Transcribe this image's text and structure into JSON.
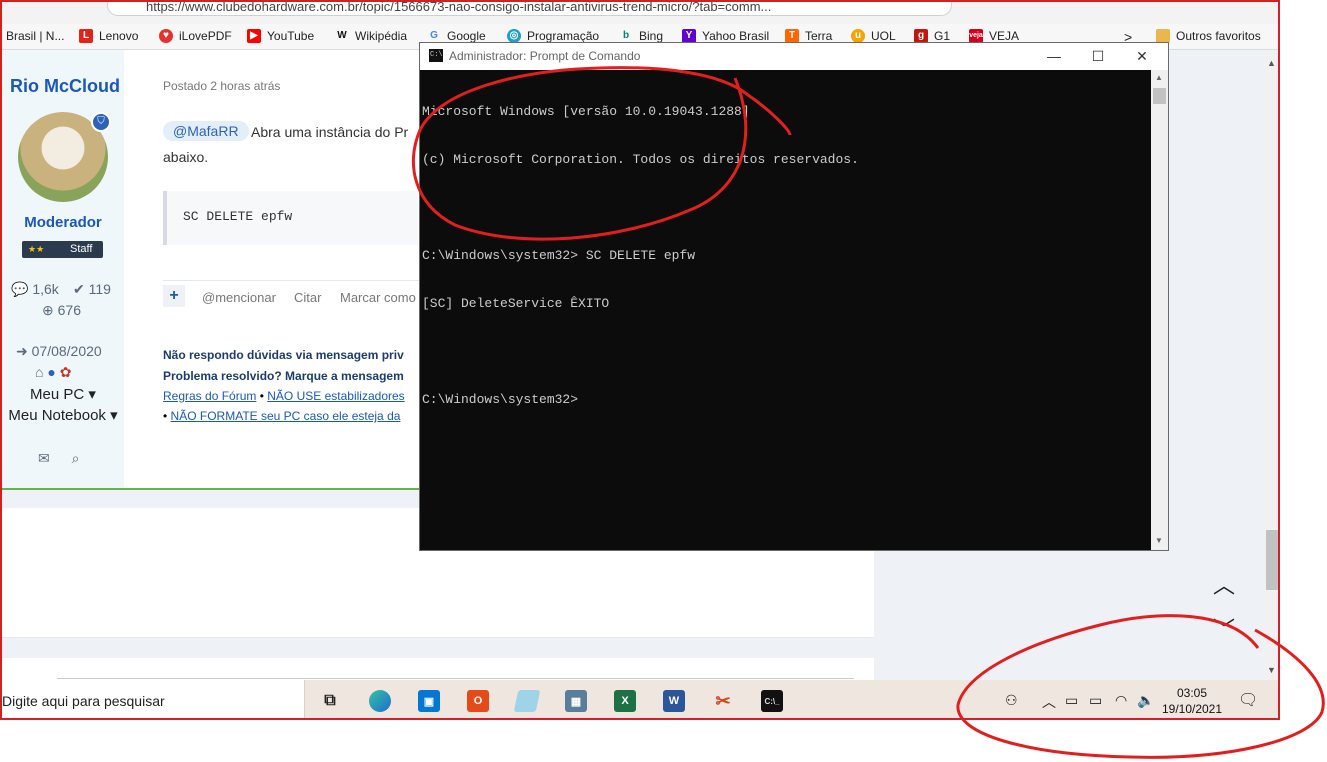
{
  "browser": {
    "url": "https://www.clubedohardware.com.br/topic/1566673-nao-consigo-instalar-antivirus-trend-micro/?tab=comm...",
    "bookmarks": [
      {
        "label": "Brasil | N..."
      },
      {
        "label": "Lenovo"
      },
      {
        "label": "iLovePDF"
      },
      {
        "label": "YouTube"
      },
      {
        "label": "Wikipédia"
      },
      {
        "label": "Google"
      },
      {
        "label": "Programação"
      },
      {
        "label": "Bing"
      },
      {
        "label": "Yahoo Brasil"
      },
      {
        "label": "Terra"
      },
      {
        "label": "UOL"
      },
      {
        "label": "G1"
      },
      {
        "label": "VEJA"
      }
    ],
    "more_chevron": ">",
    "other_favorites": "Outros favoritos"
  },
  "author": {
    "name": "Rio McCloud",
    "role": "Moderador",
    "badge": "Staff",
    "stars": "★★",
    "posts": "1,6k",
    "solutions": "119",
    "reputation": "676",
    "joined": "07/08/2020",
    "menu": [
      "Meu PC ▾",
      "Meu Notebook ▾"
    ]
  },
  "post": {
    "posted": "Postado 2 horas atrás",
    "mention": "@MafaRR",
    "text_line1": "Abra uma instância do Pr",
    "text_line2": "abaixo.",
    "code": "SC DELETE epfw",
    "actions": {
      "plus": "+",
      "mention": "@mencionar",
      "quote": "Citar",
      "mark": "Marcar como"
    },
    "signature": {
      "line1": "Não respondo dúvidas via mensagem priv",
      "line2": "Problema resolvido? Marque a mensagem",
      "link1": "Regras do Fórum",
      "sep": "•",
      "link2": "NÃO USE estabilizadores",
      "bullet": "•",
      "link3": "NÃO FORMATE seu PC caso ele esteja da"
    }
  },
  "cmd": {
    "title": "Administrador: Prompt de Comando",
    "lines": [
      "Microsoft Windows [versão 10.0.19043.1288]",
      "(c) Microsoft Corporation. Todos os direitos reservados.",
      "",
      "C:\\Windows\\system32> SC DELETE epfw",
      "[SC] DeleteService ÊXITO",
      "",
      "C:\\Windows\\system32>"
    ],
    "minimize": "—",
    "maximize": "☐",
    "close": "✕"
  },
  "taskbar": {
    "search_placeholder": "Digite aqui para pesquisar",
    "time": "03:05",
    "date": "19/10/2021"
  },
  "colors": {
    "annotation_red": "#d61f1f",
    "link_blue": "#1b58b8",
    "console_bg": "#0c0c0c",
    "console_fg": "#cccccc"
  }
}
